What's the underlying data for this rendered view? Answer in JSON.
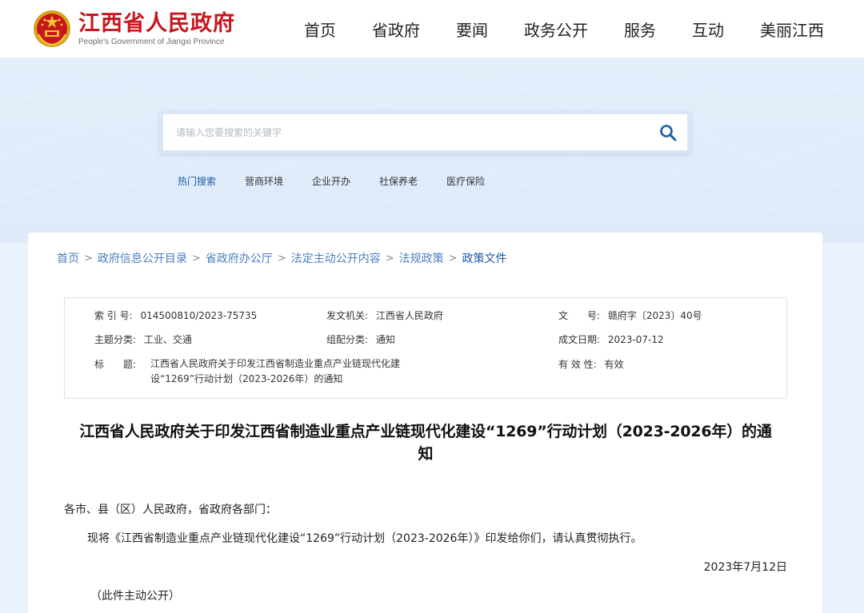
{
  "header": {
    "site_title": "江西省人民政府",
    "site_subtitle": "People's Government of Jiangxi Province",
    "nav": [
      "首页",
      "省政府",
      "要闻",
      "政务公开",
      "服务",
      "互动",
      "美丽江西"
    ]
  },
  "search": {
    "placeholder": "请输入您要搜索的关键字",
    "hot_label": "热门搜索",
    "hot_links": [
      "营商环境",
      "企业开办",
      "社保养老",
      "医疗保险"
    ]
  },
  "breadcrumb": [
    "首页",
    "政府信息公开目录",
    "省政府办公厅",
    "法定主动公开内容",
    "法规政策",
    "政策文件"
  ],
  "meta": {
    "index_key": "索 引 号:",
    "index_val": "014500810/2023-75735",
    "issuer_key": "发文机关:",
    "issuer_val": "江西省人民政府",
    "docno_key": "文　　号:",
    "docno_val": "赣府字〔2023〕40号",
    "topic_key": "主题分类:",
    "topic_val": "工业、交通",
    "org_key": "组配分类:",
    "org_val": "通知",
    "date_key": "成文日期:",
    "date_val": "2023-07-12",
    "title_key": "标　　题:",
    "title_val_line1": "江西省人民政府关于印发江西省制造业重点产业链现代化建",
    "title_val_line2": "设“1269”行动计划（2023-2026年）的通知",
    "valid_key": "有 效 性:",
    "valid_val": "有效"
  },
  "document": {
    "title_line1": "江西省人民政府关于印发江西省制造业重点产业链现代化建设“1269”行动计划（2023-2026年）的通",
    "title_line2": "知",
    "salutation": "各市、县（区）人民政府，省政府各部门：",
    "body": "现将《江西省制造业重点产业链现代化建设“1269”行动计划（2023-2026年）》印发给你们，请认真贯彻执行。",
    "date": "2023年7月12日",
    "note": "（此件主动公开）"
  },
  "colors": {
    "brand_red": "#c8161d",
    "link_blue": "#4a7fbf",
    "hero_bg": "#e3eefb"
  }
}
